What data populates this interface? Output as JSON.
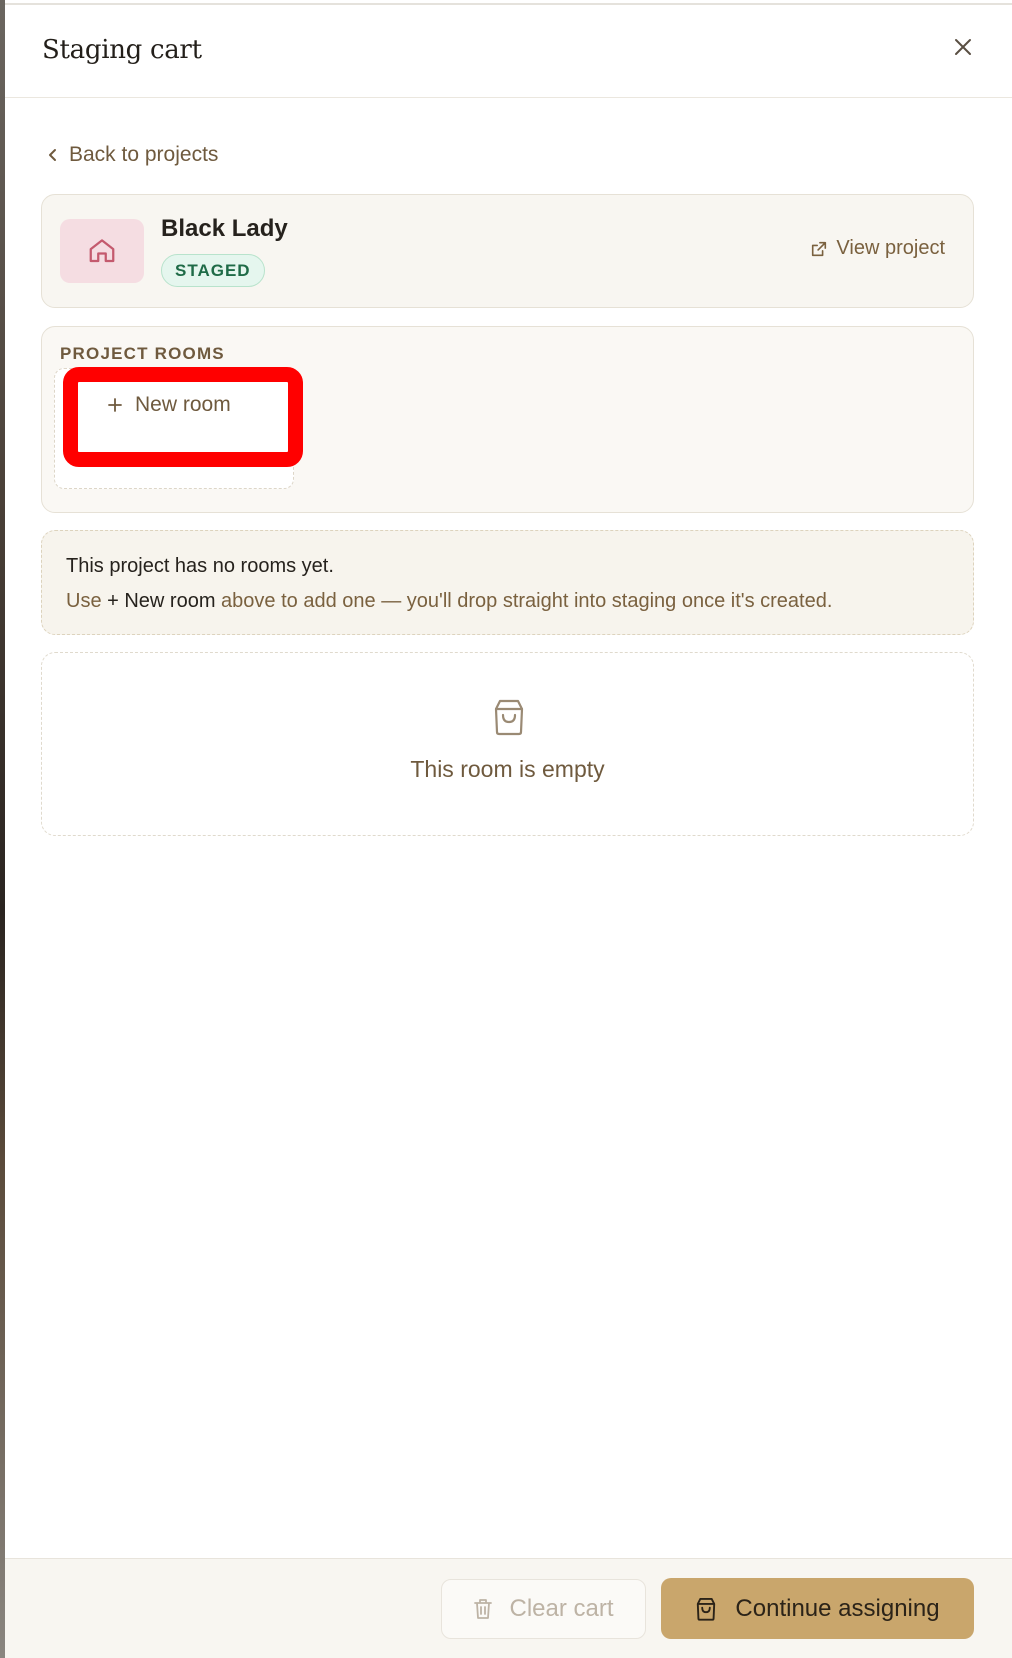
{
  "header": {
    "title": "Staging cart",
    "close_icon": "close-icon"
  },
  "nav": {
    "back_label": "Back to projects"
  },
  "project": {
    "name": "Black Lady",
    "status": "STAGED",
    "view_label": "View project",
    "avatar_icon": "home-icon",
    "avatar_color": "#f5dde2",
    "status_color": "#1f6b47"
  },
  "rooms": {
    "section_label": "PROJECT ROOMS",
    "new_room_label": "New room"
  },
  "notice": {
    "title": "This project has no rooms yet.",
    "body_prefix": "Use ",
    "body_strong": "+ New room",
    "body_suffix": " above to add one — you'll drop straight into staging once it's created."
  },
  "empty_state": {
    "text": "This room is empty",
    "icon": "shopping-bag-icon"
  },
  "footer": {
    "clear_label": "Clear cart",
    "continue_label": "Continue assigning",
    "accent_color": "#c9a66c"
  },
  "annotation": {
    "highlight_color": "#ff0000"
  }
}
